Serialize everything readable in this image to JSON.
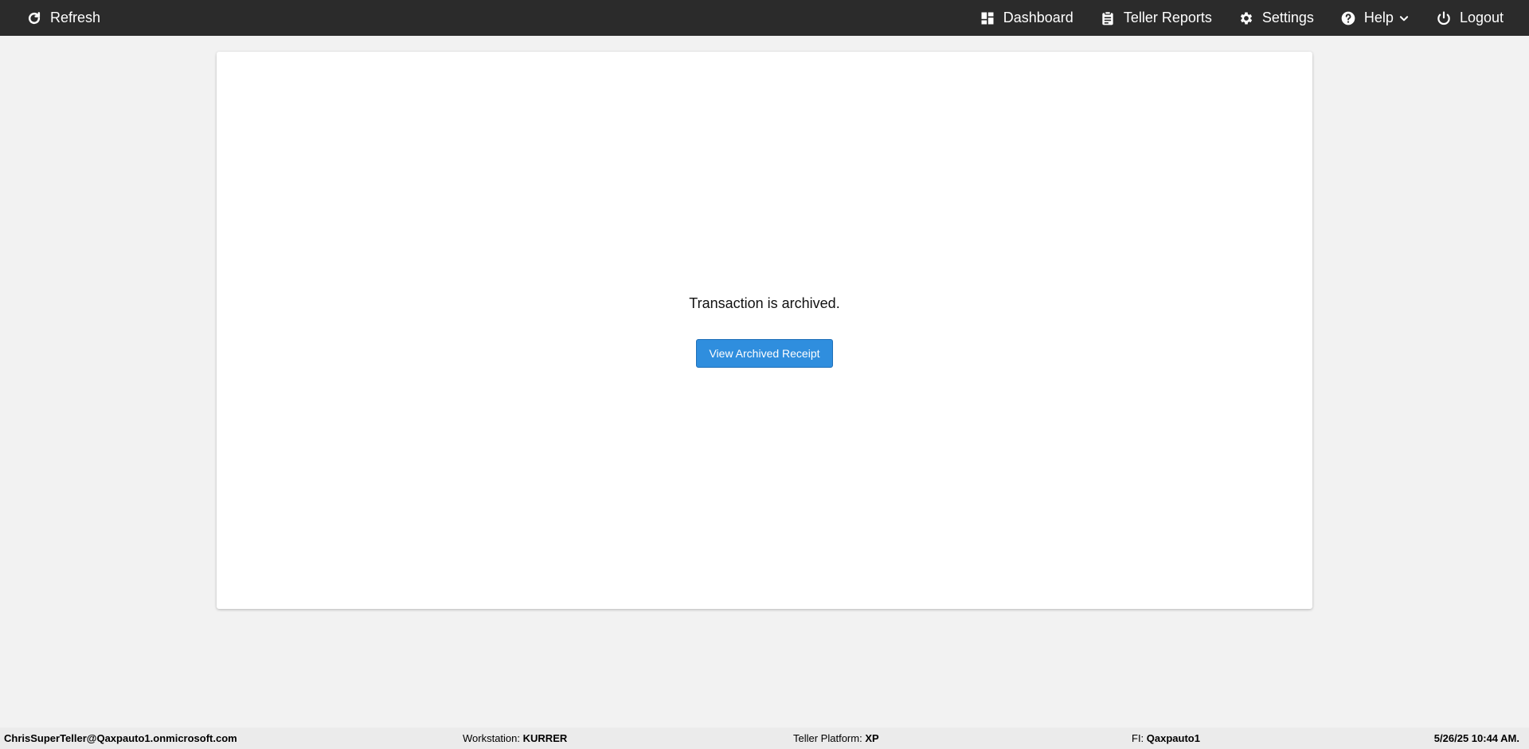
{
  "topbar": {
    "refresh_label": "Refresh",
    "dashboard_label": "Dashboard",
    "teller_reports_label": "Teller Reports",
    "settings_label": "Settings",
    "help_label": "Help",
    "logout_label": "Logout",
    "icons": [
      "refresh-icon",
      "dashboard-icon",
      "clipboard-icon",
      "gear-icon",
      "help-circle-icon",
      "chevron-down-icon",
      "power-icon"
    ],
    "background_color": "#2b2b2b"
  },
  "main": {
    "message": "Transaction is archived.",
    "view_receipt_label": "View Archived Receipt",
    "button_color": "#2f8ede"
  },
  "footer": {
    "user": "ChrisSuperTeller@Qaxpauto1.onmicrosoft.com",
    "workstation_label": "Workstation:",
    "workstation_value": "KURRER",
    "platform_label": "Teller Platform:",
    "platform_value": "XP",
    "fi_label": "FI:",
    "fi_value": "Qaxpauto1",
    "datetime": "5/26/25 10:44 AM."
  }
}
